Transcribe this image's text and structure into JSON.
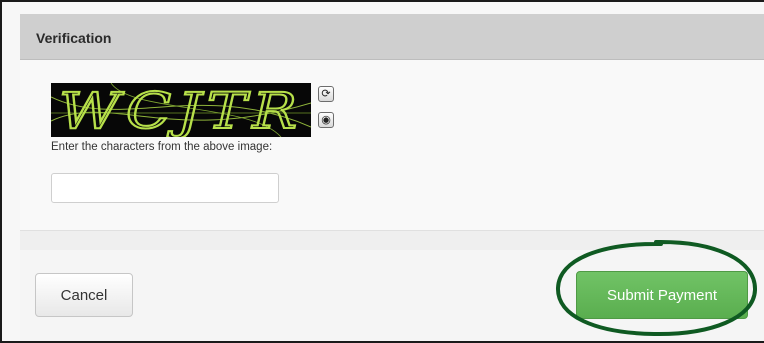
{
  "panel": {
    "title": "Verification"
  },
  "captcha": {
    "image_text": "WCJTR",
    "hint": "Enter the characters from the above image:",
    "input_value": "",
    "refresh_icon": "refresh-icon",
    "audio_icon": "audio-icon"
  },
  "actions": {
    "cancel_label": "Cancel",
    "submit_label": "Submit Payment"
  },
  "colors": {
    "header_bg": "#cfcfcf",
    "submit_green": "#5cb85c",
    "captcha_text": "#b7e04a",
    "highlight_ring": "#0f5a22"
  }
}
